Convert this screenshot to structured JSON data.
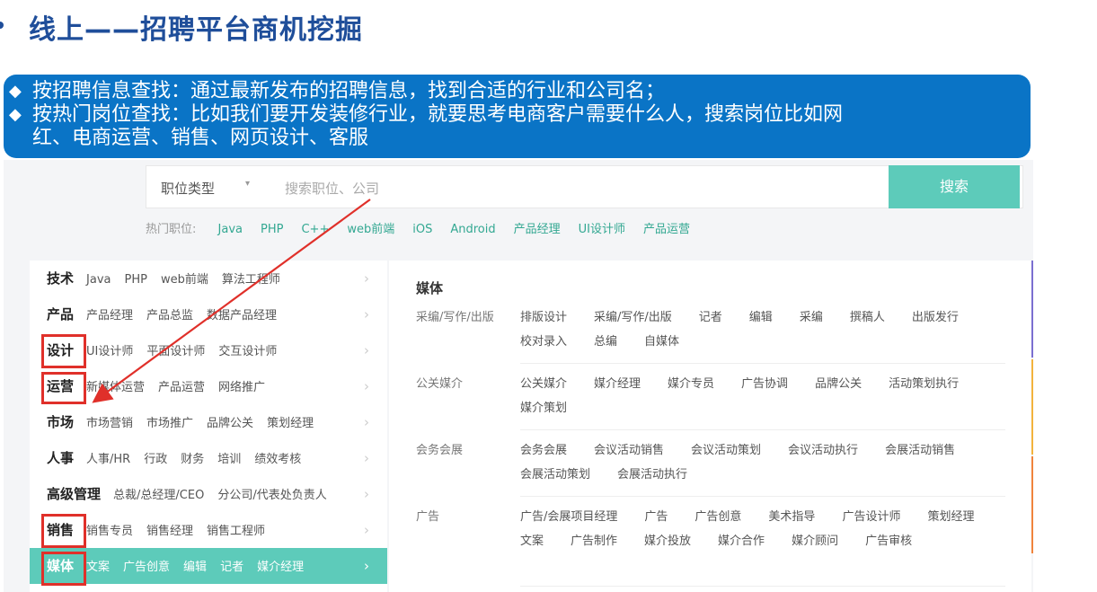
{
  "slide": {
    "title": "线上——招聘平台商机挖掘",
    "bullets": [
      {
        "mark": "◆",
        "lines": [
          "按招聘信息查找：通过最新发布的招聘信息，找到合适的行业和公司名；"
        ]
      },
      {
        "mark": "◆",
        "lines": [
          "按热门岗位查找：比如我们要开发装修行业，就要思考电商客户需要什么人，搜索岗位比如网",
          "红、电商运营、销售、网页设计、客服"
        ]
      }
    ]
  },
  "search": {
    "type_label": "职位类型",
    "caret": "▾",
    "placeholder": "搜索职位、公司",
    "button": "搜索"
  },
  "hot": {
    "label": "热门职位:",
    "items": [
      "Java",
      "PHP",
      "C++",
      "web前端",
      "iOS",
      "Android",
      "产品经理",
      "UI设计师",
      "产品运营"
    ]
  },
  "categories": [
    {
      "name": "技术",
      "tags": [
        "Java",
        "PHP",
        "web前端",
        "算法工程师"
      ]
    },
    {
      "name": "产品",
      "tags": [
        "产品经理",
        "产品总监",
        "数据产品经理"
      ]
    },
    {
      "name": "设计",
      "tags": [
        "UI设计师",
        "平面设计师",
        "交互设计师"
      ]
    },
    {
      "name": "运营",
      "tags": [
        "新媒体运营",
        "产品运营",
        "网络推广"
      ]
    },
    {
      "name": "市场",
      "tags": [
        "市场营销",
        "市场推广",
        "品牌公关",
        "策划经理"
      ]
    },
    {
      "name": "人事",
      "tags": [
        "人事/HR",
        "行政",
        "财务",
        "培训",
        "绩效考核"
      ]
    },
    {
      "name": "高级管理",
      "tags": [
        "总裁/总经理/CEO",
        "分公司/代表处负责人"
      ]
    },
    {
      "name": "销售",
      "tags": [
        "销售专员",
        "销售经理",
        "销售工程师"
      ]
    },
    {
      "name": "媒体",
      "tags": [
        "文案",
        "广告创意",
        "编辑",
        "记者",
        "媒介经理"
      ]
    }
  ],
  "chevron": "›",
  "detail": {
    "title": "媒体",
    "groups": [
      {
        "label": "采编/写作/出版",
        "items": [
          "排版设计",
          "采编/写作/出版",
          "记者",
          "编辑",
          "采编",
          "撰稿人",
          "出版发行",
          "校对录入",
          "总编",
          "自媒体"
        ]
      },
      {
        "label": "公关媒介",
        "items": [
          "公关媒介",
          "媒介经理",
          "媒介专员",
          "广告协调",
          "品牌公关",
          "活动策划执行",
          "媒介策划"
        ]
      },
      {
        "label": "会务会展",
        "items": [
          "会务会展",
          "会议活动销售",
          "会议活动策划",
          "会议活动执行",
          "会展活动销售",
          "会展活动策划",
          "会展活动执行"
        ]
      },
      {
        "label": "广告",
        "items": [
          "广告/会展项目经理",
          "广告",
          "广告创意",
          "美术指导",
          "广告设计师",
          "策划经理",
          "文案",
          "广告制作",
          "媒介投放",
          "媒介合作",
          "媒介顾问",
          "广告审核"
        ]
      }
    ]
  },
  "colors": {
    "title": "#1F4E9A",
    "banner": "#0A74C6",
    "accent": "#5DCBBA",
    "highlight": "#E0302A",
    "edge_bars": [
      "#7B6FD0",
      "#F2B33D",
      "#F0843C"
    ]
  }
}
